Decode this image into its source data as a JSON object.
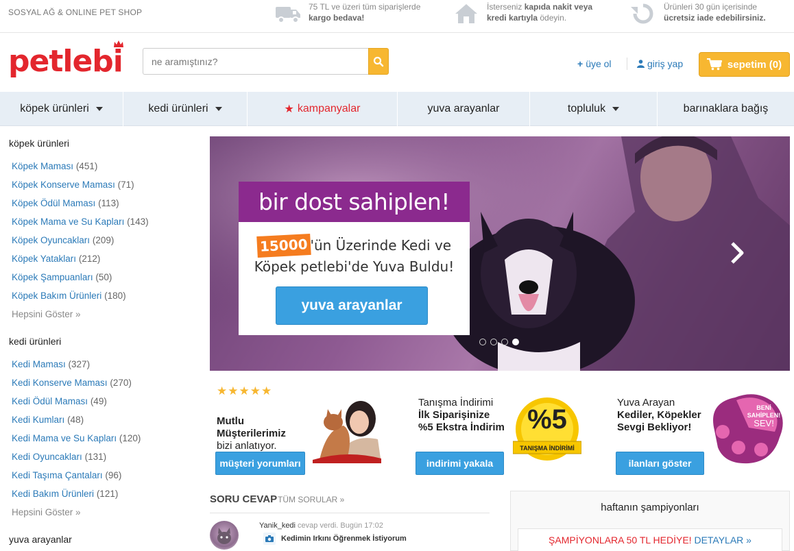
{
  "topbar": {
    "tagline": "SOSYAL AĞ & ONLINE PET SHOP",
    "perks": [
      {
        "icon": "truck-icon",
        "line1": "75 TL ve üzeri tüm siparişlerde",
        "line2": "kargo bedava!"
      },
      {
        "icon": "home-icon",
        "line1a": "İsterseniz ",
        "line1b": "kapıda nakit veya",
        "line2a": "kredi kartıyla",
        "line2b": " ödeyin."
      },
      {
        "icon": "return-icon",
        "line1": "Ürünleri 30 gün içerisinde",
        "line2": "ücretsiz iade edebilirsiniz."
      }
    ]
  },
  "header": {
    "logo": "petlebi",
    "search_placeholder": "ne aramıştınız?",
    "signup": "üye ol",
    "login": "giriş yap",
    "cart": "sepetim (0)"
  },
  "nav": [
    {
      "label": "köpek ürünleri",
      "caret": true
    },
    {
      "label": "kedi ürünleri",
      "caret": true
    },
    {
      "label": "kampanyalar",
      "caret": false
    },
    {
      "label": "yuva arayanlar",
      "caret": false
    },
    {
      "label": "topluluk",
      "caret": true
    },
    {
      "label": "barınaklara bağış",
      "caret": false
    }
  ],
  "sidebar": {
    "dog": {
      "title": "köpek ürünleri",
      "items": [
        {
          "label": "Köpek Maması",
          "count": "(451)"
        },
        {
          "label": "Köpek Konserve Maması",
          "count": "(71)"
        },
        {
          "label": "Köpek Ödül Maması",
          "count": "(113)"
        },
        {
          "label": "Köpek Mama ve Su Kapları",
          "count": "(143)"
        },
        {
          "label": "Köpek Oyuncakları",
          "count": "(209)"
        },
        {
          "label": "Köpek Yatakları",
          "count": "(212)"
        },
        {
          "label": "Köpek Şampuanları",
          "count": "(50)"
        },
        {
          "label": "Köpek Bakım Ürünleri",
          "count": "(180)"
        }
      ],
      "more": "Hepsini Göster »"
    },
    "cat": {
      "title": "kedi ürünleri",
      "items": [
        {
          "label": "Kedi Maması",
          "count": "(327)"
        },
        {
          "label": "Kedi Konserve Maması",
          "count": "(270)"
        },
        {
          "label": "Kedi Ödül Maması",
          "count": "(49)"
        },
        {
          "label": "Kedi Kumları",
          "count": "(48)"
        },
        {
          "label": "Kedi Mama ve Su Kapları",
          "count": "(120)"
        },
        {
          "label": "Kedi Oyuncakları",
          "count": "(131)"
        },
        {
          "label": "Kedi Taşıma Çantaları",
          "count": "(96)"
        },
        {
          "label": "Kedi Bakım Ürünleri",
          "count": "(121)"
        }
      ],
      "more": "Hepsini Göster »"
    },
    "adopt_title": "yuva arayanlar"
  },
  "hero": {
    "headline": "bir dost sahiplen!",
    "highlight": "15000",
    "text_after_hl": "'ün Üzerinde Kedi ve",
    "text_line2": "Köpek petlebi'de Yuva Buldu!",
    "button": "yuva arayanlar",
    "slides": 4,
    "active_slide": 4
  },
  "tiles": [
    {
      "stars": "★★★★★",
      "title1": "Mutlu",
      "title2": "Müşterilerimiz",
      "title3": "bizi anlatıyor.",
      "button": "müşteri yorumları"
    },
    {
      "title1": "Tanışma İndirimi",
      "title2": "İlk Siparişinize",
      "title3": "%5 Ekstra İndirim",
      "badge_big": "%5",
      "badge_small": "TANIŞMA İNDİRİMİ",
      "button": "indirimi yakala"
    },
    {
      "title1": "Yuva Arayan",
      "title2": "Kediler, Köpekler",
      "title3": "Sevgi Bekliyor!",
      "paw_line1": "BENİ",
      "paw_line2": "SAHİPLEN!",
      "paw_line3": "SEV!",
      "button": "ilanları göster"
    }
  ],
  "qa": {
    "title": "SORU CEVAP",
    "all": "TÜM SORULAR »",
    "user": "Yanik_kedi",
    "action": " cevap verdi. Bugün 17:02",
    "question": "Kedimin Irkını Öğrenmek İstiyorum"
  },
  "champions": {
    "title": "haftanın şampiyonları",
    "promo_red": "ŞAMPİYONLARA 50 TL HEDİYE! ",
    "promo_link": "DETAYLAR »"
  },
  "colors": {
    "brand_red": "#e3262d",
    "accent_yellow": "#f7b731",
    "link_blue": "#2b7ab8",
    "button_blue": "#3aa0e0",
    "promo_purple": "#8b2a8e",
    "nav_bg": "#e7eef5"
  }
}
